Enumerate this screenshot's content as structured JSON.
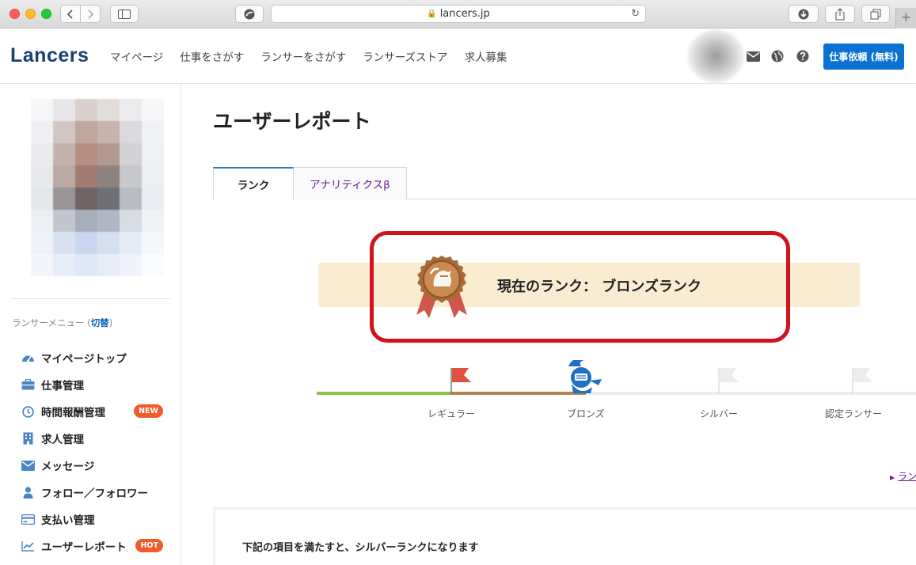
{
  "browser": {
    "url": "lancers.jp",
    "new_tab_glyph": "+"
  },
  "header": {
    "logo": "Lancers",
    "nav": [
      "マイページ",
      "仕事をさがす",
      "ランサーをさがす",
      "ランサーズストア",
      "求人募集"
    ],
    "cta_label": "仕事依頼 (無料)",
    "icons": [
      "mail-icon",
      "globe-icon",
      "help-icon"
    ]
  },
  "sidebar": {
    "menu_heading": "ランサーメニュー (",
    "menu_switch": "切替",
    "menu_heading_close": ")",
    "items": [
      {
        "label": "マイページトップ",
        "icon": "dashboard-icon",
        "badge": ""
      },
      {
        "label": "仕事管理",
        "icon": "briefcase-icon",
        "badge": ""
      },
      {
        "label": "時間報酬管理",
        "icon": "clock-icon",
        "badge": "NEW"
      },
      {
        "label": "求人管理",
        "icon": "building-icon",
        "badge": ""
      },
      {
        "label": "メッセージ",
        "icon": "envelope-icon",
        "badge": ""
      },
      {
        "label": "フォロー／フォロワー",
        "icon": "user-icon",
        "badge": ""
      },
      {
        "label": "支払い管理",
        "icon": "credit-card-icon",
        "badge": ""
      },
      {
        "label": "ユーザーレポート",
        "icon": "line-chart-icon",
        "badge": "HOT"
      }
    ]
  },
  "main": {
    "page_title": "ユーザーレポート",
    "tabs": [
      {
        "label": "ランク",
        "active": true
      },
      {
        "label": "アナリティクスβ",
        "active": false
      }
    ],
    "current_rank_text": "現在のランク： ブロンズランク",
    "rank_steps": [
      "レギュラー",
      "ブロンズ",
      "シルバー",
      "認定ランサー"
    ],
    "current_step_index": 1,
    "more_link": "ラン",
    "requirements_heading": "下記の項目を満たすと、シルバーランクになります"
  },
  "colors": {
    "brand": "#1c3f73",
    "cta": "#0b72d1",
    "highlight": "#d0121b",
    "banner": "#f9ecd1",
    "bronze": "#b9814f",
    "regular": "#8bc34a",
    "badge": "#f05b2d"
  }
}
